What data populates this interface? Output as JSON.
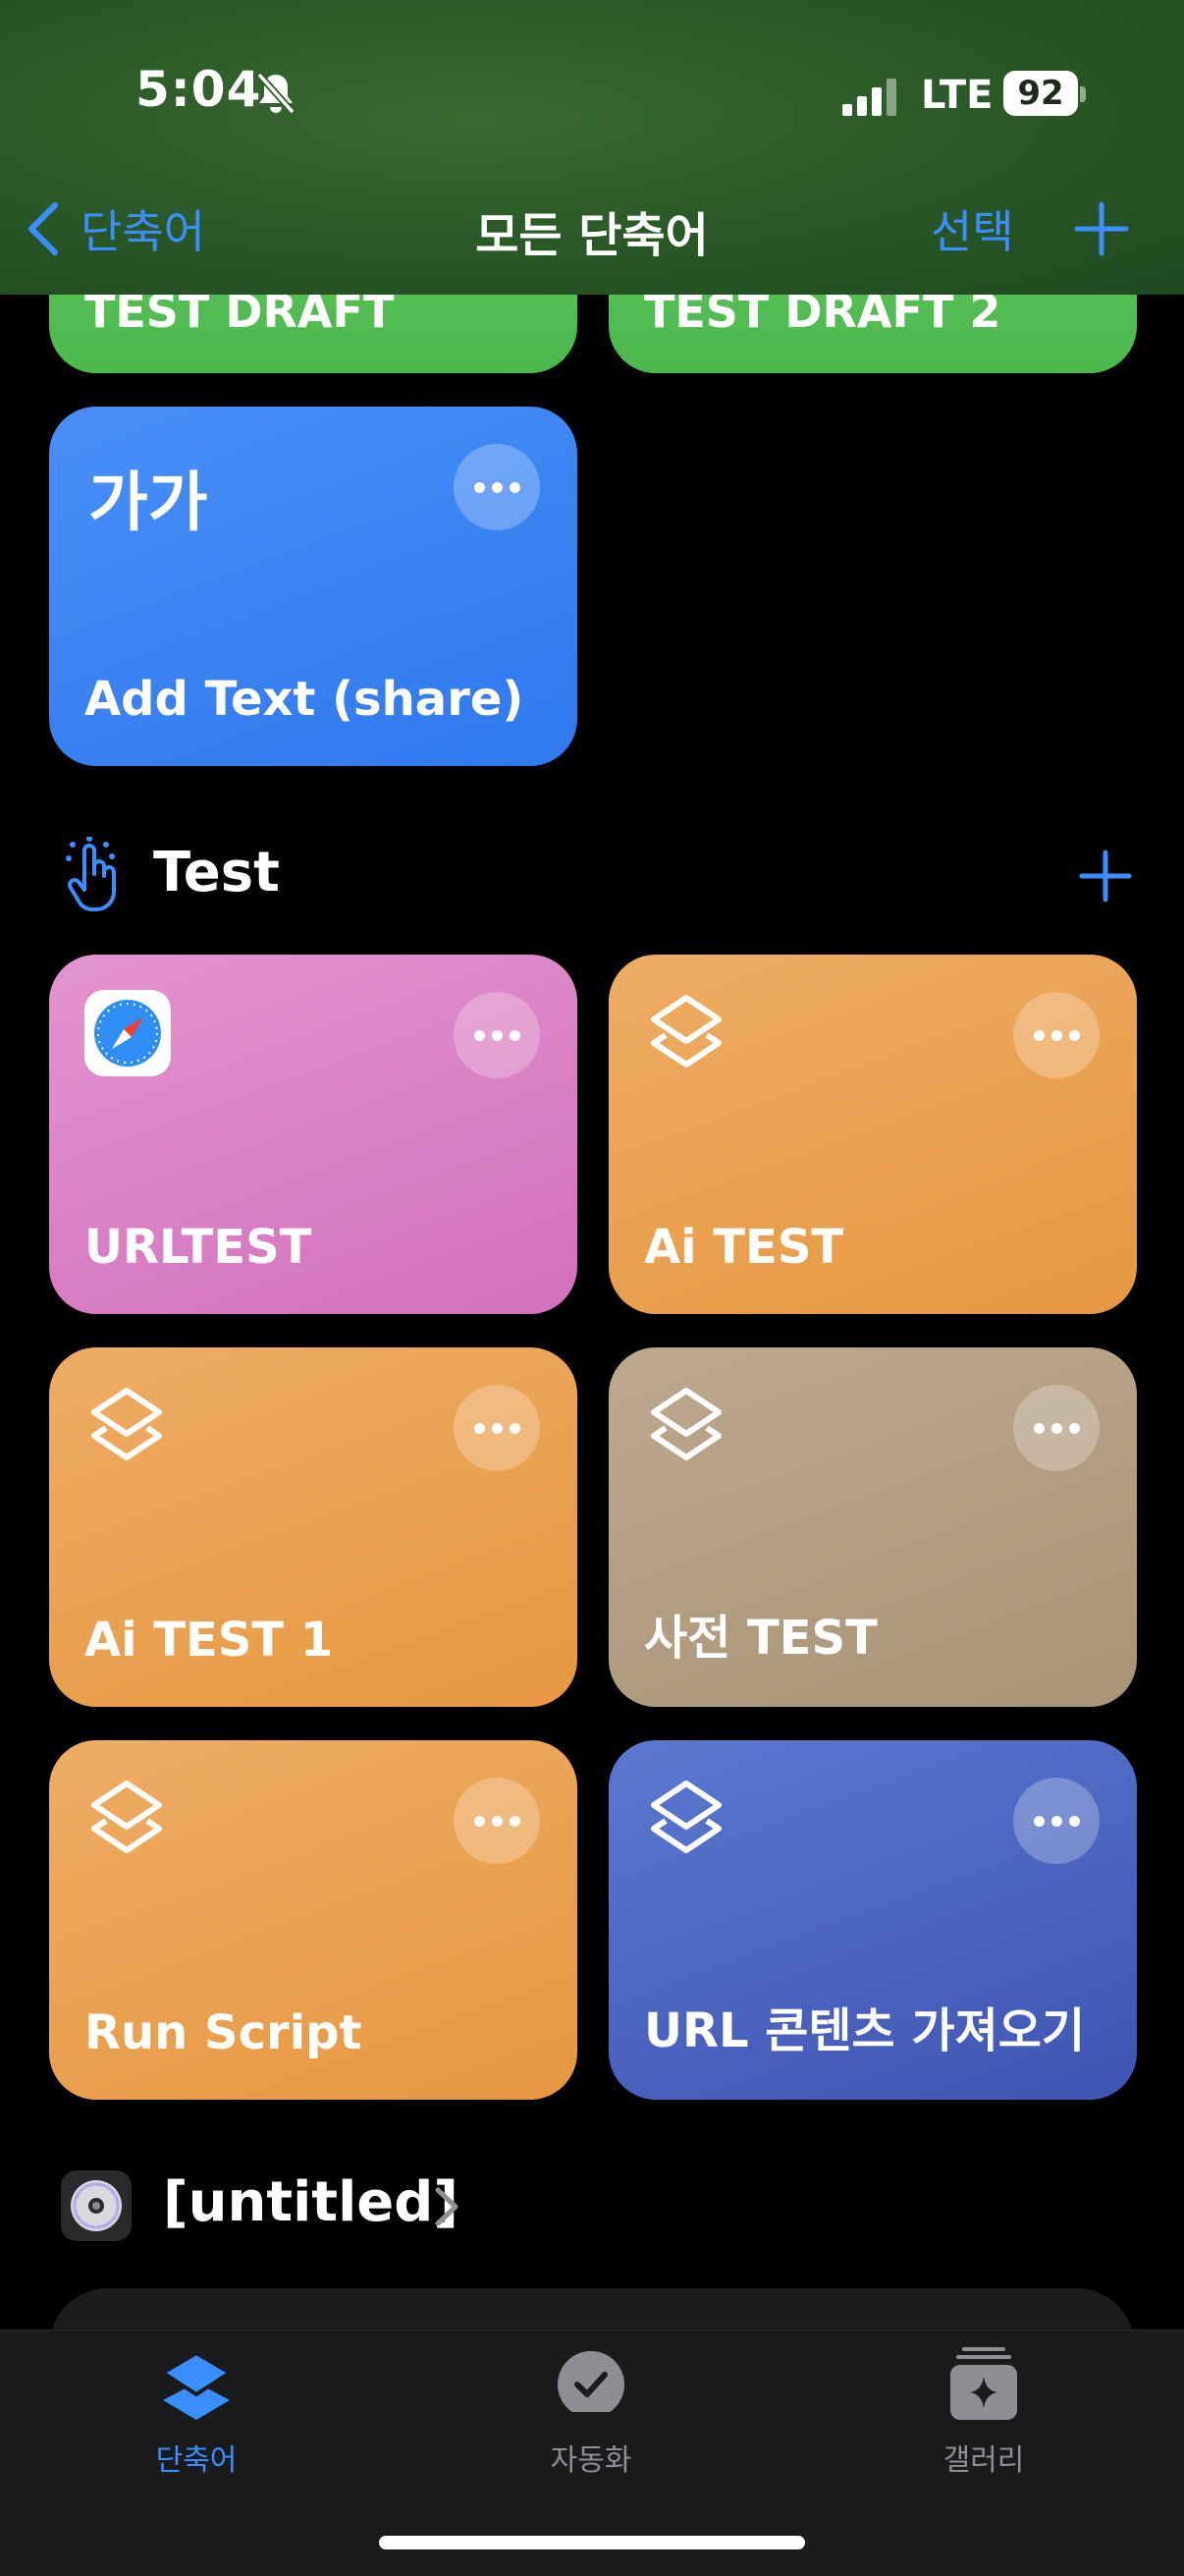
{
  "status_bar": {
    "time": "5:04",
    "network": "LTE",
    "battery": "92"
  },
  "nav": {
    "back_label": "단축어",
    "title": "모든 단축어",
    "select_label": "선택"
  },
  "top_cards": [
    {
      "title": "TEST DRAFT"
    },
    {
      "title": "TEST DRAFT 2"
    }
  ],
  "add_text_card": {
    "glyph": "가가",
    "title": "Add Text (share)"
  },
  "section_test": {
    "title": "Test"
  },
  "test_cards": [
    {
      "title": "URLTEST"
    },
    {
      "title": "Ai TEST"
    },
    {
      "title": "Ai TEST 1"
    },
    {
      "title": "사전 TEST"
    },
    {
      "title": "Run Script"
    },
    {
      "title": "URL 콘텐츠 가져오기"
    }
  ],
  "section_untitled": {
    "title": "[untitled]"
  },
  "tabs": [
    {
      "label": "단축어",
      "active": true
    },
    {
      "label": "자동화",
      "active": false
    },
    {
      "label": "갤러리",
      "active": false
    }
  ],
  "colors": {
    "accent": "#3b8eff",
    "green": "#53bd53",
    "blue": "#3a84f3",
    "pink": "#db82c5",
    "orange": "#eaa252",
    "taupe": "#b39e83",
    "indigo": "#4d66c1"
  }
}
